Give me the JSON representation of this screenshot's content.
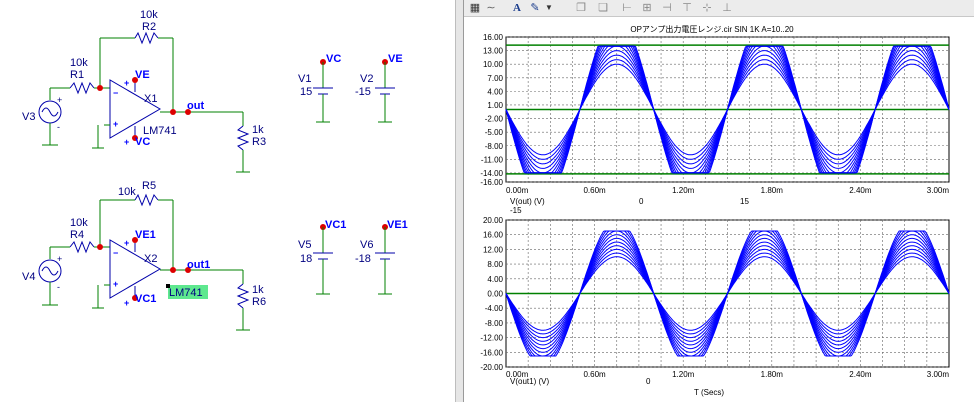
{
  "schematic": {
    "circuit1": {
      "r2_value": "10k",
      "r2_name": "R2",
      "r1_value": "10k",
      "r1_name": "R1",
      "source_name": "V3",
      "opamp_name": "X1",
      "opamp_model": "LM741",
      "pos_supply": "VE",
      "neg_supply": "VC",
      "output_node": "out",
      "load_value": "1k",
      "load_name": "R3",
      "v1_name": "V1",
      "v1_value": "15",
      "v1_node": "VC",
      "v2_name": "V2",
      "v2_value": "-15",
      "v2_node": "VE"
    },
    "circuit2": {
      "r5_value": "10k",
      "r5_name": "R5",
      "r4_value": "10k",
      "r4_name": "R4",
      "source_name": "V4",
      "opamp_name": "X2",
      "opamp_model": "LM741",
      "pos_supply": "VE1",
      "neg_supply": "VC1",
      "output_node": "out1",
      "load_value": "1k",
      "load_name": "R6",
      "v5_name": "V5",
      "v5_value": "18",
      "v5_node": "VC1",
      "v6_name": "V6",
      "v6_value": "-18",
      "v6_node": "VE1"
    }
  },
  "toolbar": {
    "icons": [
      "grid-menu-icon",
      "curve-icon",
      "font-icon",
      "spell-icon",
      "dropdown-arrow-icon",
      "copy-icon",
      "paste-icon",
      "align-left-icon",
      "align-center-icon",
      "align-right-icon",
      "align-top-icon",
      "align-middle-icon",
      "align-bottom-icon"
    ]
  },
  "chart_data": [
    {
      "type": "line",
      "title": "OPアンプ出力電圧レンジ.cir SIN 1K A=10..20",
      "xlabel": "",
      "trace_label": "V(out) (V)",
      "bottom_values": [
        "-15",
        "0",
        "15"
      ],
      "x_ticks": [
        "0.00m",
        "0.60m",
        "1.20m",
        "1.80m",
        "2.40m",
        "3.00m"
      ],
      "y_ticks": [
        "16.00",
        "13.00",
        "10.00",
        "7.00",
        "4.00",
        "1.00",
        "-2.00",
        "-5.00",
        "-8.00",
        "-11.00",
        "-14.00",
        "-16.00"
      ],
      "y_tick_values": [
        16,
        13,
        10,
        7,
        4,
        1,
        -2,
        -5,
        -8,
        -11,
        -14,
        -16
      ],
      "ylim": [
        -16,
        16
      ],
      "xlim_ms": [
        0,
        3
      ],
      "rail_lines": [
        14.2,
        0,
        -14.2
      ],
      "series": [
        {
          "amplitude": 10
        },
        {
          "amplitude": 11
        },
        {
          "amplitude": 12
        },
        {
          "amplitude": 13
        },
        {
          "amplitude": 14
        },
        {
          "amplitude": 15
        },
        {
          "amplitude": 16
        },
        {
          "amplitude": 17
        },
        {
          "amplitude": 18
        },
        {
          "amplitude": 19
        },
        {
          "amplitude": 20
        }
      ],
      "frequency_khz": 1,
      "clip_level": 14.0,
      "inverted": true,
      "grid": true,
      "line_color": "#0000ff",
      "axis_line_color": "#008000"
    },
    {
      "type": "line",
      "xlabel": "T (Secs)",
      "trace_label": "V(out1) (V)",
      "bottom_values": [
        "0"
      ],
      "x_ticks": [
        "0.00m",
        "0.60m",
        "1.20m",
        "1.80m",
        "2.40m",
        "3.00m"
      ],
      "y_ticks": [
        "20.00",
        "16.00",
        "12.00",
        "8.00",
        "4.00",
        "0.00",
        "-4.00",
        "-8.00",
        "-12.00",
        "-16.00",
        "-20.00"
      ],
      "y_tick_values": [
        20,
        16,
        12,
        8,
        4,
        0,
        -4,
        -8,
        -12,
        -16,
        -20
      ],
      "ylim": [
        -20,
        20
      ],
      "xlim_ms": [
        0,
        3
      ],
      "rail_lines": [
        0
      ],
      "series": [
        {
          "amplitude": 10
        },
        {
          "amplitude": 11
        },
        {
          "amplitude": 12
        },
        {
          "amplitude": 13
        },
        {
          "amplitude": 14
        },
        {
          "amplitude": 15
        },
        {
          "amplitude": 16
        },
        {
          "amplitude": 17
        },
        {
          "amplitude": 18
        },
        {
          "amplitude": 19
        },
        {
          "amplitude": 20
        }
      ],
      "frequency_khz": 1,
      "clip_level": 17.0,
      "inverted": true,
      "grid": true,
      "line_color": "#0000ff",
      "axis_line_color": "#008000"
    }
  ]
}
